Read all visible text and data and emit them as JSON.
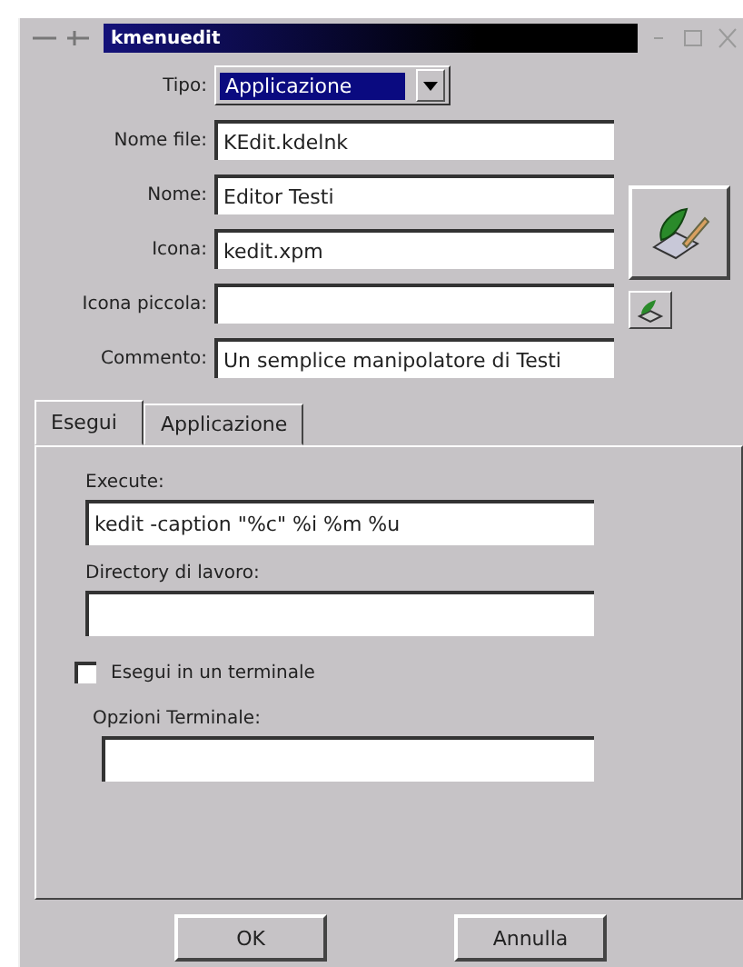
{
  "window": {
    "title": "kmenuedit"
  },
  "type_field": {
    "label": "Tipo:",
    "value": "Applicazione",
    "highlighted": true
  },
  "fields": [
    {
      "label": "Nome file:",
      "value": "KEdit.kdelnk"
    },
    {
      "label": "Nome:",
      "value": "Editor Testi"
    },
    {
      "label": "Icona:",
      "value": "kedit.xpm"
    },
    {
      "label": "Icona piccola:"
    },
    {
      "label": "Commento:",
      "value": "Un semplice manipolatore di Testi"
    }
  ],
  "tabs": [
    {
      "label": "Esegui",
      "selected": true
    },
    {
      "label": "Applicazione",
      "selected": false
    }
  ],
  "panel_fields": [
    {
      "label": "Execute:",
      "value": "kedit -caption \"%c\" %i %m %u"
    },
    {
      "label": "Directory di lavoro:"
    }
  ],
  "terminal_checkbox": {
    "label": "Esegui in un terminale",
    "checked": false
  },
  "terminal_options": {
    "label": "Opzioni Terminale:"
  },
  "buttons": [
    "OK",
    "Annulla"
  ]
}
